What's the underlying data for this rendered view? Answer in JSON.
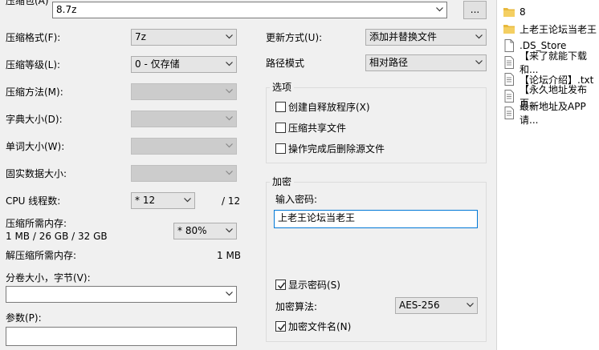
{
  "archive": {
    "label": "压缩包(A)",
    "path": "8.7z",
    "browse": "..."
  },
  "left": {
    "format_label": "压缩格式(F):",
    "format_value": "7z",
    "level_label": "压缩等级(L):",
    "level_value": "0 - 仅存储",
    "method_label": "压缩方法(M):",
    "dict_label": "字典大小(D):",
    "word_label": "单词大小(W):",
    "solid_label": "固实数据大小:",
    "cpu_label": "CPU 线程数:",
    "cpu_value": "* 12",
    "cpu_total": "/ 12",
    "mem_label": "压缩所需内存:",
    "mem_detail": "1 MB / 26 GB / 32 GB",
    "mem_percent": "* 80%",
    "decomp_label": "解压缩所需内存:",
    "decomp_value": "1 MB",
    "split_label": "分卷大小，字节(V):",
    "split_value": "",
    "params_label": "参数(P):",
    "params_value": ""
  },
  "right": {
    "update_label": "更新方式(U):",
    "update_value": "添加并替换文件",
    "path_label": "路径模式",
    "path_value": "相对路径",
    "options_title": "选项",
    "opt_sfx": "创建自释放程序(X)",
    "opt_shared": "压缩共享文件",
    "opt_delete": "操作完成后删除源文件",
    "enc_title": "加密",
    "pwd_label": "输入密码:",
    "pwd_value": "上老王论坛当老王",
    "show_pwd": "显示密码(S)",
    "algo_label": "加密算法:",
    "algo_value": "AES-256",
    "enc_names": "加密文件名(N)"
  },
  "files": [
    {
      "name": "8",
      "icon": "folder-icon"
    },
    {
      "name": "上老王论坛当老王",
      "icon": "folder-icon"
    },
    {
      "name": ".DS_Store",
      "icon": "file-icon"
    },
    {
      "name": "【来了就能下载和...",
      "icon": "text-file-icon"
    },
    {
      "name": "【论坛介绍】.txt",
      "icon": "text-file-icon"
    },
    {
      "name": "【永久地址发布页...",
      "icon": "text-file-icon"
    },
    {
      "name": "最新地址及APP请...",
      "icon": "text-file-icon"
    }
  ],
  "colors": {
    "dialog_bg": "#f0f0f0",
    "folder": "#e8b93c",
    "select_bg": "#e5e5e5",
    "disabled_bg": "#cccccc"
  }
}
